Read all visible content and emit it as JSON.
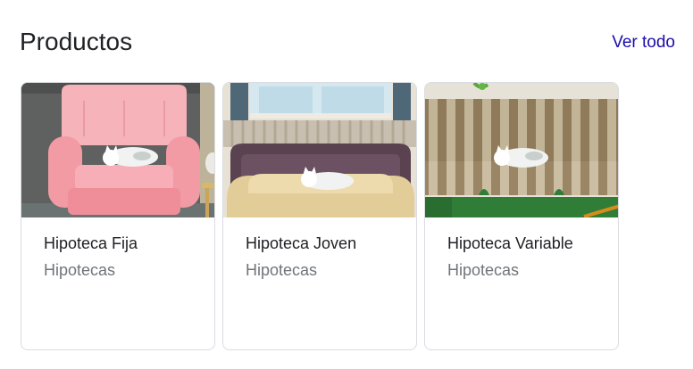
{
  "section": {
    "title": "Productos",
    "see_all_label": "Ver todo"
  },
  "products": [
    {
      "title": "Hipoteca Fija",
      "subtitle": "Hipotecas",
      "image": "cat-on-pink-armchair"
    },
    {
      "title": "Hipoteca Joven",
      "subtitle": "Hipotecas",
      "image": "cat-on-bed"
    },
    {
      "title": "Hipoteca Variable",
      "subtitle": "Hipotecas",
      "image": "cat-on-striped-couch"
    }
  ]
}
